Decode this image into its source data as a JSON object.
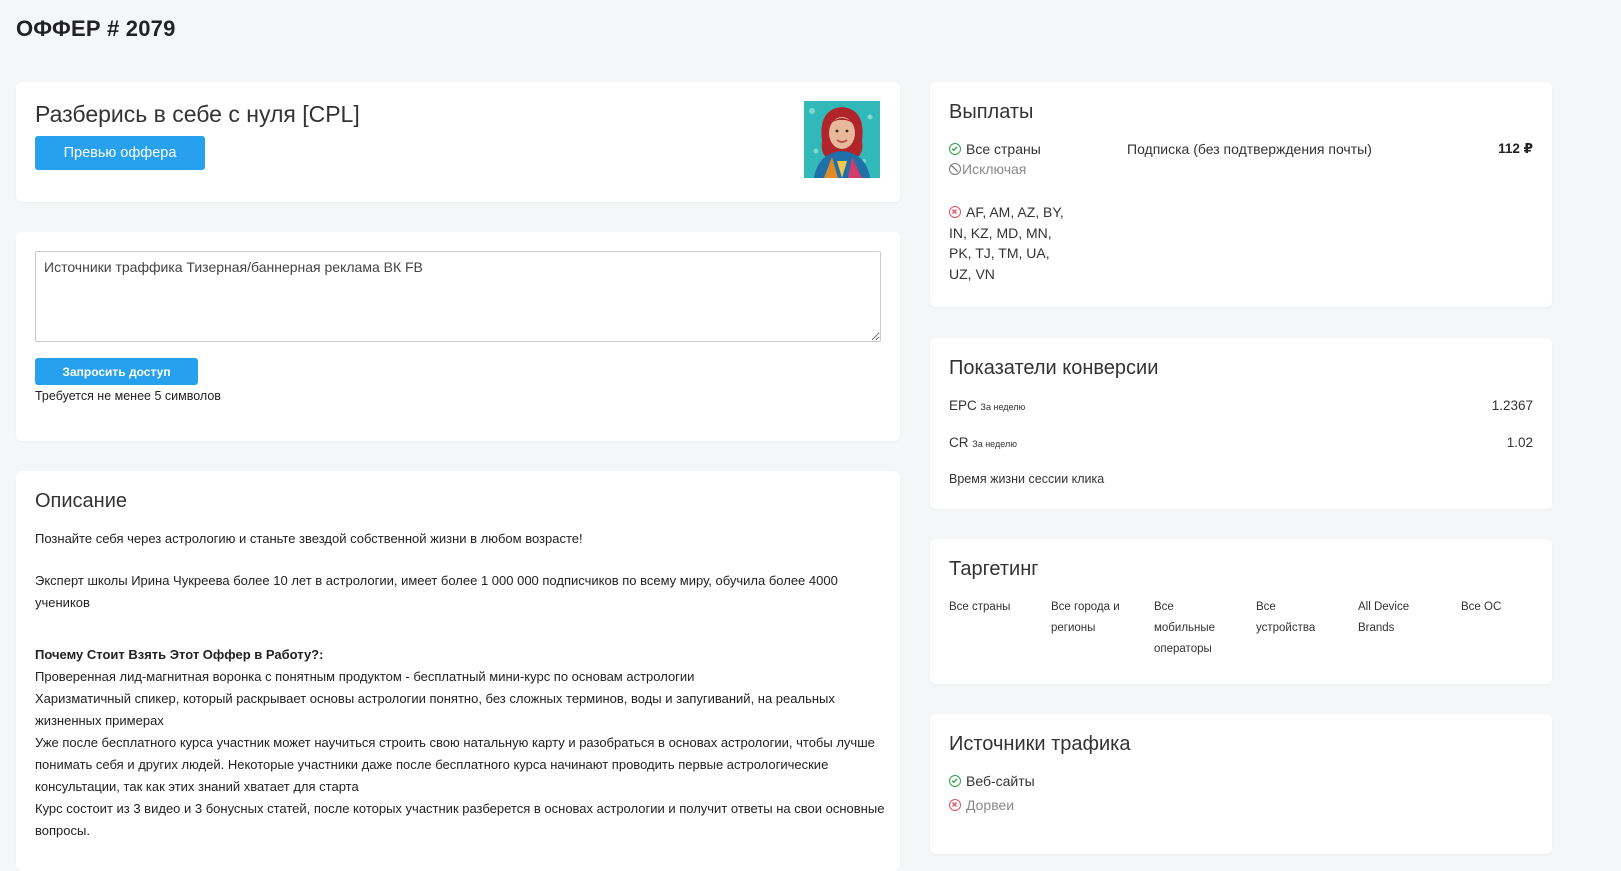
{
  "page": {
    "title": "ОФФЕР # 2079"
  },
  "offer": {
    "name": "Разберись в себе с нуля [CPL]",
    "preview_button": "Превью оффера",
    "thumbnail_alt": "offer-avatar"
  },
  "access": {
    "textarea_value": "Источники траффика Тизерная/баннерная реклама ВК FB",
    "request_button": "Запросить доступ",
    "hint": "Требуется не менее 5 символов"
  },
  "description": {
    "heading": "Описание",
    "intro": "Познайте себя через астрологию и станьте звездой собственной жизни в любом возрасте!",
    "expert": "Эксперт школы Ирина Чукреева более 10 лет в астрологии, имеет более 1 000 000 подписчиков по всему миру, обучила более 4000 учеников",
    "why_heading": "Почему Стоит Взять Этот Оффер в Работу?:",
    "points": [
      "Проверенная лид-магнитная воронка с понятным продуктом - бесплатный мини-курс по основам астрологии",
      "Харизматичный спикер, который раскрывает основы астрологии понятно, без сложных терминов, воды и запугиваний, на реальных жизненных примерах",
      "Уже после бесплатного курса участник может научиться строить свою натальную карту и разобраться в основах астрологии, чтобы лучше понимать себя и других людей. Некоторые участники даже после бесплатного курса начинают проводить первые астрологические консультации, так как этих знаний хватает для старта",
      "Курс состоит из 3 видео и 3 бонусных статей, после которых участник разберется в основах астрологии и получит ответы на свои основные вопросы."
    ]
  },
  "payouts": {
    "heading": "Выплаты",
    "all_countries": "Все страны",
    "excluding": "Исключая",
    "goal": "Подписка (без подтверждения почты)",
    "amount": "112 ₽",
    "excluded_countries": [
      "AF, AM, AZ, BY,",
      "IN, KZ, MD, MN,",
      "PK, TJ, TM, UA,",
      "UZ, VN"
    ]
  },
  "conversion": {
    "heading": "Показатели конверсии",
    "epc_label": "EPC",
    "epc_period": "За неделю",
    "epc_value": "1.2367",
    "cr_label": "CR",
    "cr_period": "За неделю",
    "cr_value": "1.02",
    "session_label": "Время жизни сессии клика"
  },
  "targeting": {
    "heading": "Таргетинг",
    "columns": [
      [
        "Все страны"
      ],
      [
        "Все города и",
        "регионы"
      ],
      [
        "Все",
        "мобильные",
        "операторы"
      ],
      [
        "Все",
        "устройства"
      ],
      [
        "All Device",
        "Brands"
      ],
      [
        "Все ОС"
      ]
    ]
  },
  "traffic": {
    "heading": "Источники трафика",
    "allowed": "Веб-сайты",
    "denied": "Дорвеи"
  },
  "colors": {
    "accent": "#27a0ee",
    "ok": "#28a745",
    "bad": "#e04f5f",
    "background": "#f5f6f8"
  }
}
